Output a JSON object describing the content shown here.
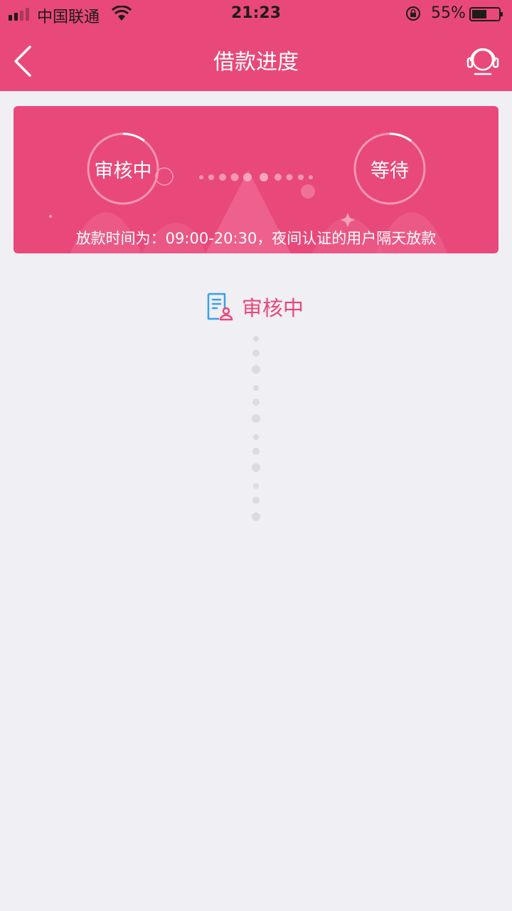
{
  "status_bar": {
    "carrier": "中国联通",
    "time": "21:23",
    "battery": "55%",
    "battery_level": 0.55
  },
  "nav": {
    "title": "借款进度",
    "back_icon": "chevron-left-icon",
    "service_icon": "headset-icon"
  },
  "banner": {
    "stage_1": "审核中",
    "stage_2": "等待",
    "notice": "放款时间为：09:00-20:30，夜间认证的用户隔天放款"
  },
  "current": {
    "label": "审核中",
    "icon": "document-user-icon"
  },
  "colors": {
    "brand": "#e9487a",
    "background": "#efeff4",
    "icon_blue": "#3aa0e8"
  }
}
